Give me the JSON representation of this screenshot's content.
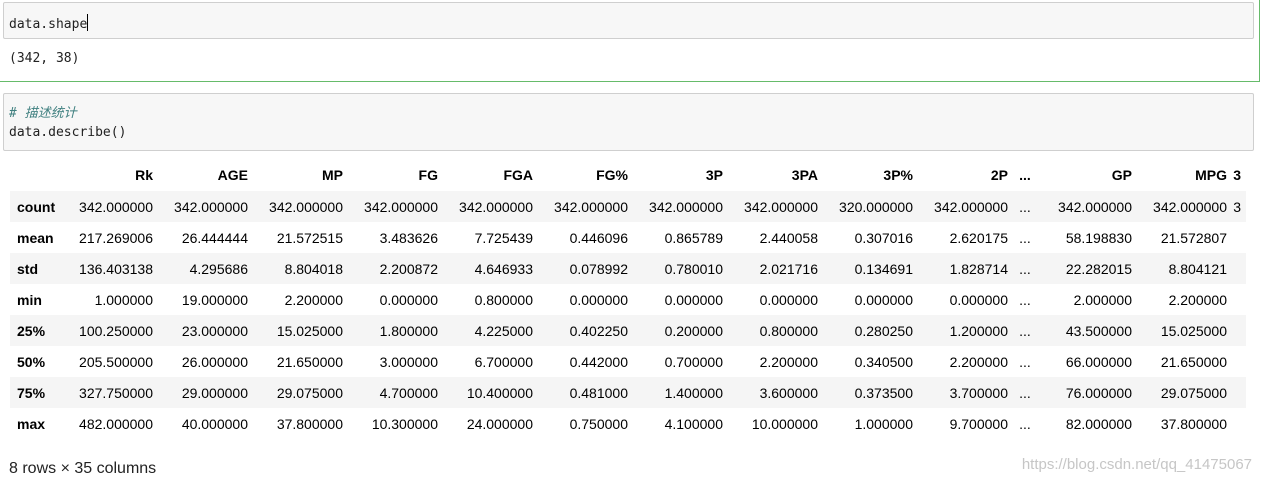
{
  "cell1": {
    "input_code": "data.shape",
    "output": "(342, 38)"
  },
  "cell2": {
    "comment": "# 描述统计",
    "input_code": "data.describe()"
  },
  "table": {
    "columns": [
      "Rk",
      "AGE",
      "MP",
      "FG",
      "FGA",
      "FG%",
      "3P",
      "3PA",
      "3P%",
      "2P",
      "...",
      "GP",
      "MPG",
      "3"
    ],
    "rows": [
      {
        "label": "count",
        "values": [
          "342.000000",
          "342.000000",
          "342.000000",
          "342.000000",
          "342.000000",
          "342.000000",
          "342.000000",
          "342.000000",
          "320.000000",
          "342.000000",
          "...",
          "342.000000",
          "342.000000",
          "3"
        ]
      },
      {
        "label": "mean",
        "values": [
          "217.269006",
          "26.444444",
          "21.572515",
          "3.483626",
          "7.725439",
          "0.446096",
          "0.865789",
          "2.440058",
          "0.307016",
          "2.620175",
          "...",
          "58.198830",
          "21.572807",
          ""
        ]
      },
      {
        "label": "std",
        "values": [
          "136.403138",
          "4.295686",
          "8.804018",
          "2.200872",
          "4.646933",
          "0.078992",
          "0.780010",
          "2.021716",
          "0.134691",
          "1.828714",
          "...",
          "22.282015",
          "8.804121",
          ""
        ]
      },
      {
        "label": "min",
        "values": [
          "1.000000",
          "19.000000",
          "2.200000",
          "0.000000",
          "0.800000",
          "0.000000",
          "0.000000",
          "0.000000",
          "0.000000",
          "0.000000",
          "...",
          "2.000000",
          "2.200000",
          ""
        ]
      },
      {
        "label": "25%",
        "values": [
          "100.250000",
          "23.000000",
          "15.025000",
          "1.800000",
          "4.225000",
          "0.402250",
          "0.200000",
          "0.800000",
          "0.280250",
          "1.200000",
          "...",
          "43.500000",
          "15.025000",
          ""
        ]
      },
      {
        "label": "50%",
        "values": [
          "205.500000",
          "26.000000",
          "21.650000",
          "3.000000",
          "6.700000",
          "0.442000",
          "0.700000",
          "2.200000",
          "0.340500",
          "2.200000",
          "...",
          "66.000000",
          "21.650000",
          ""
        ]
      },
      {
        "label": "75%",
        "values": [
          "327.750000",
          "29.000000",
          "29.075000",
          "4.700000",
          "10.400000",
          "0.481000",
          "1.400000",
          "3.600000",
          "0.373500",
          "3.700000",
          "...",
          "76.000000",
          "29.075000",
          ""
        ]
      },
      {
        "label": "max",
        "values": [
          "482.000000",
          "40.000000",
          "37.800000",
          "10.300000",
          "24.000000",
          "0.750000",
          "4.100000",
          "10.000000",
          "1.000000",
          "9.700000",
          "...",
          "82.000000",
          "37.800000",
          ""
        ]
      }
    ],
    "shape_text": "8 rows × 35 columns"
  },
  "watermark": "https://blog.csdn.net/qq_41475067",
  "colors": {
    "selected_cell_border": "#66bb6a",
    "comment": "#408080",
    "input_bg": "#f7f7f7"
  }
}
